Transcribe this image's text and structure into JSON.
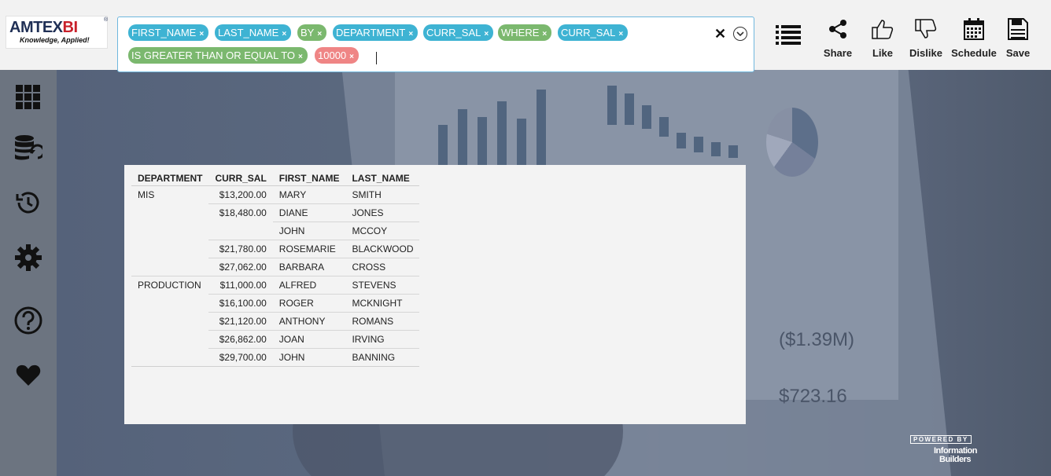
{
  "brand": {
    "logo_prefix": "AMTEX",
    "logo_suffix": "BI",
    "logo_reg": "®",
    "tagline": "Knowledge, Applied!",
    "colors": {
      "primary": "#1f2f55",
      "accent": "#c8202a"
    }
  },
  "query": {
    "tokens": [
      {
        "label": "FIRST_NAME",
        "kind": "field",
        "color": "#3eb3d3"
      },
      {
        "label": "LAST_NAME",
        "kind": "field",
        "color": "#3eb3d3"
      },
      {
        "label": "BY",
        "kind": "keyword",
        "color": "#7bb86e"
      },
      {
        "label": "DEPARTMENT",
        "kind": "field",
        "color": "#3eb3d3"
      },
      {
        "label": "CURR_SAL",
        "kind": "field",
        "color": "#3eb3d3"
      },
      {
        "label": "WHERE",
        "kind": "keyword",
        "color": "#7bb86e"
      },
      {
        "label": "CURR_SAL",
        "kind": "field",
        "color": "#3eb3d3"
      },
      {
        "label": "IS GREATER THAN OR EQUAL TO",
        "kind": "operator",
        "color": "#7bb86e"
      },
      {
        "label": "10000",
        "kind": "value",
        "color": "#ef8585"
      }
    ],
    "remove_glyph": "×",
    "clear_glyph": "✕"
  },
  "toolbar": {
    "share_label": "Share",
    "like_label": "Like",
    "dislike_label": "Dislike",
    "schedule_label": "Schedule",
    "save_label": "Save"
  },
  "sidebar": {
    "items": [
      {
        "icon": "grid-icon"
      },
      {
        "icon": "database-refresh-icon"
      },
      {
        "icon": "history-icon"
      },
      {
        "icon": "gear-icon"
      },
      {
        "icon": "help-icon"
      },
      {
        "icon": "heart-icon"
      }
    ]
  },
  "report": {
    "columns": [
      "DEPARTMENT",
      "CURR_SAL",
      "FIRST_NAME",
      "LAST_NAME"
    ],
    "rows": [
      {
        "dept": "MIS",
        "sal": "$13,200.00",
        "first": "MARY",
        "last": "SMITH"
      },
      {
        "dept": "",
        "sal": "$18,480.00",
        "first": "DIANE",
        "last": "JONES"
      },
      {
        "dept": "",
        "sal": "",
        "first": "JOHN",
        "last": "MCCOY"
      },
      {
        "dept": "",
        "sal": "$21,780.00",
        "first": "ROSEMARIE",
        "last": "BLACKWOOD"
      },
      {
        "dept": "",
        "sal": "$27,062.00",
        "first": "BARBARA",
        "last": "CROSS"
      },
      {
        "dept": "PRODUCTION",
        "sal": "$11,000.00",
        "first": "ALFRED",
        "last": "STEVENS"
      },
      {
        "dept": "",
        "sal": "$16,100.00",
        "first": "ROGER",
        "last": "MCKNIGHT"
      },
      {
        "dept": "",
        "sal": "$21,120.00",
        "first": "ANTHONY",
        "last": "ROMANS"
      },
      {
        "dept": "",
        "sal": "$26,862.00",
        "first": "JOAN",
        "last": "IRVING"
      },
      {
        "dept": "",
        "sal": "$29,700.00",
        "first": "JOHN",
        "last": "BANNING"
      }
    ]
  },
  "background_dashboard": {
    "kpi_1": "($1.39M)",
    "kpi_2": "$723.16"
  },
  "footer": {
    "powered_by": "POWERED BY",
    "vendor_line1": "Information",
    "vendor_line2": "Builders"
  }
}
